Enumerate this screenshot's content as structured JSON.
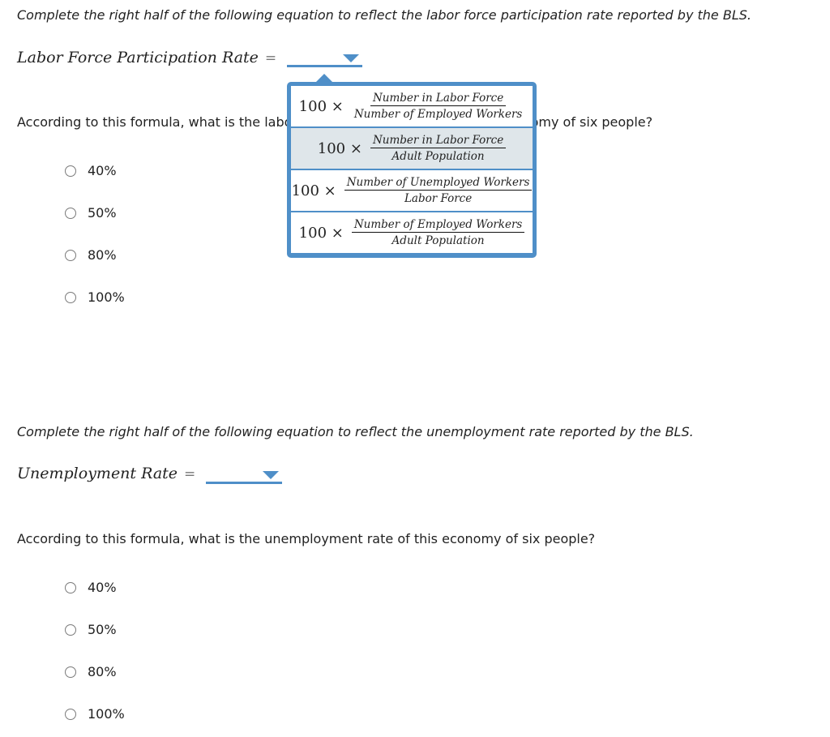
{
  "section1": {
    "instruction": "Complete the right half of the following equation to reflect the labor force participation rate reported by the BLS.",
    "equation_lhs": "Labor Force Participation Rate",
    "equals": "=",
    "dropdown_value": "",
    "question": "According to this formula, what is the labor force participation rate of this economy of six people?",
    "options": [
      "40%",
      "50%",
      "80%",
      "100%"
    ]
  },
  "dropdown_popup": {
    "items": [
      {
        "coefficient": "100 ×",
        "numerator": "Number in Labor Force",
        "denominator": "Number of Employed Workers"
      },
      {
        "coefficient": "100 ×",
        "numerator": "Number in Labor Force",
        "denominator": "Adult Population"
      },
      {
        "coefficient": "100 ×",
        "numerator": "Number of Unemployed Workers",
        "denominator": "Labor Force"
      },
      {
        "coefficient": "100 ×",
        "numerator": "Number of Employed Workers",
        "denominator": "Adult Population"
      }
    ],
    "highlighted_index": 1
  },
  "section2": {
    "instruction": "Complete the right half of the following equation to reflect the unemployment rate reported by the BLS.",
    "equation_lhs": "Unemployment Rate",
    "equals": "=",
    "dropdown_value": "",
    "question": "According to this formula, what is the unemployment rate of this economy of six people?",
    "options": [
      "40%",
      "50%",
      "80%",
      "100%"
    ]
  },
  "colors": {
    "accent": "#4f8fc8",
    "highlight": "#dfe6ea",
    "text": "#222222"
  }
}
